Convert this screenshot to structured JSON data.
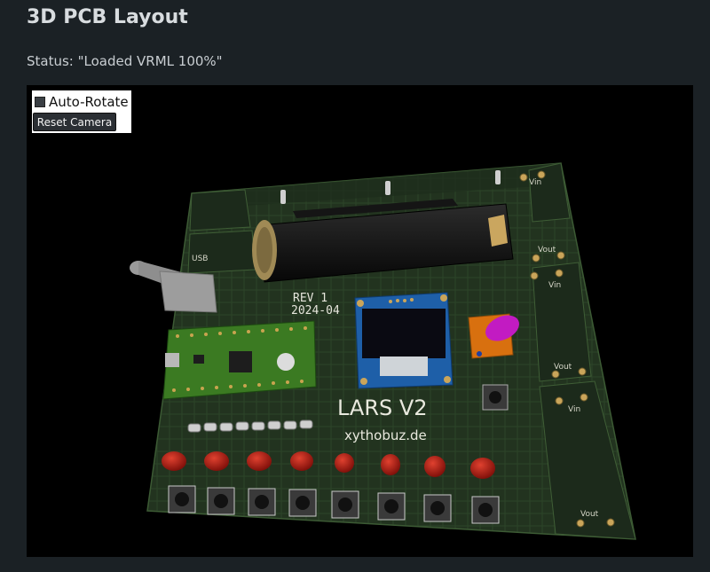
{
  "page": {
    "title": "3D PCB Layout",
    "status": "Status: \"Loaded VRML 100%\""
  },
  "controls": {
    "auto_rotate_label": "Auto-Rotate",
    "auto_rotate_checked": false,
    "reset_label": "Reset Camera"
  },
  "pcb": {
    "rev_text": "REV 1",
    "date_text": "2024-04",
    "name_text": "LARS V2",
    "url_text": "xythobuz.de",
    "usb_label": "USB",
    "vin_label": "Vin",
    "vout_label": "Vout",
    "colors": {
      "board": "#1f3020",
      "pico": "#3a7a22",
      "oled_frame": "#1e5fa8",
      "led": "#b51a12",
      "encoder": "#d8700f",
      "knob": "#c21bc2",
      "battery": "#1a1a1a"
    }
  }
}
